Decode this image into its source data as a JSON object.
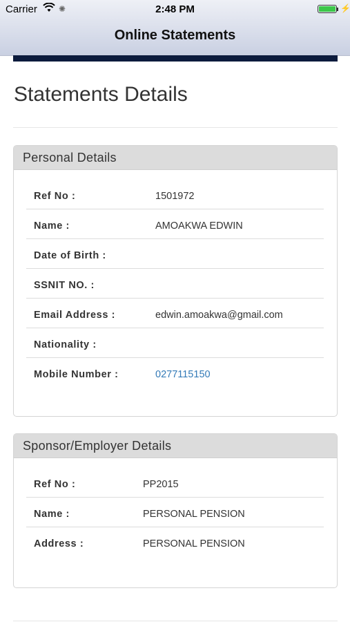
{
  "status_bar": {
    "carrier": "Carrier",
    "time": "2:48 PM"
  },
  "nav": {
    "title": "Online Statements"
  },
  "page": {
    "title": "Statements Details"
  },
  "personal": {
    "heading": "Personal Details",
    "rows": [
      {
        "label": "Ref No :",
        "value": "1501972"
      },
      {
        "label": "Name :",
        "value": "AMOAKWA EDWIN"
      },
      {
        "label": "Date of Birth :",
        "value": ""
      },
      {
        "label": "SSNIT NO. :",
        "value": ""
      },
      {
        "label": "Email Address :",
        "value": "edwin.amoakwa@gmail.com"
      },
      {
        "label": "Nationality :",
        "value": ""
      },
      {
        "label": "Mobile Number :",
        "value": "0277115150"
      }
    ]
  },
  "sponsor": {
    "heading": "Sponsor/Employer Details",
    "rows": [
      {
        "label": "Ref No :",
        "value": "PP2015"
      },
      {
        "label": "Name :",
        "value": "PERSONAL PENSION"
      },
      {
        "label": "Address :",
        "value": "PERSONAL PENSION"
      }
    ]
  },
  "colors": {
    "link": "#337ab7",
    "header_band": "#0c1b3d",
    "battery": "#3cc74a"
  }
}
